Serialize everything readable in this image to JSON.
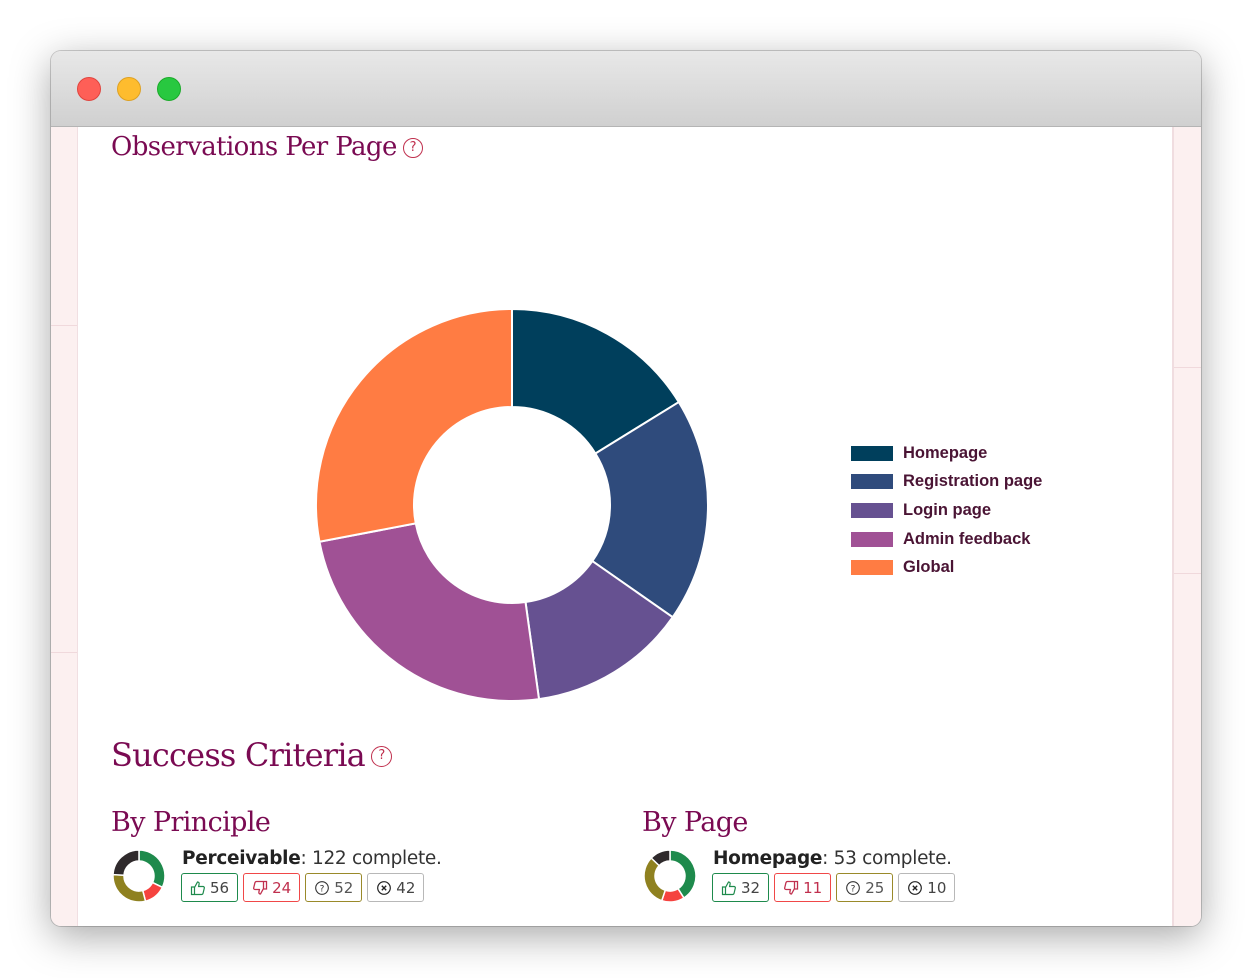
{
  "window": {
    "controls": [
      "close",
      "minimize",
      "maximize"
    ]
  },
  "observations": {
    "title": "Observations Per Page",
    "help_icon": "?"
  },
  "chart_data": {
    "type": "pie",
    "variant": "donut",
    "title": "Observations Per Page",
    "categories": [
      "Homepage",
      "Registration page",
      "Login page",
      "Admin feedback",
      "Global"
    ],
    "values": [
      16.2,
      18.5,
      13.1,
      24.2,
      28.0
    ],
    "value_units": "percent of total (estimated from slice angles)",
    "colors": [
      "#003f5c",
      "#2f4b7c",
      "#665191",
      "#a05195",
      "#ff7c43"
    ],
    "legend_position": "right"
  },
  "success_criteria": {
    "title": "Success Criteria",
    "help_icon": "?",
    "by_principle": {
      "title": "By Principle",
      "name": "Perceivable",
      "summary": ": 122 complete.",
      "counts": {
        "pass": "56",
        "fail": "24",
        "cannot_tell": "52",
        "not_present": "42"
      },
      "values": [
        56,
        24,
        52,
        42
      ]
    },
    "by_page": {
      "title": "By Page",
      "name": "Homepage",
      "summary": ": 53 complete.",
      "counts": {
        "pass": "32",
        "fail": "11",
        "cannot_tell": "25",
        "not_present": "10"
      },
      "values": [
        32,
        11,
        25,
        10
      ]
    },
    "status_colors": {
      "pass": "#1e8a4c",
      "fail": "#f5433f",
      "cannot_tell": "#8f8120",
      "not_present": "#2f2a2c"
    }
  }
}
